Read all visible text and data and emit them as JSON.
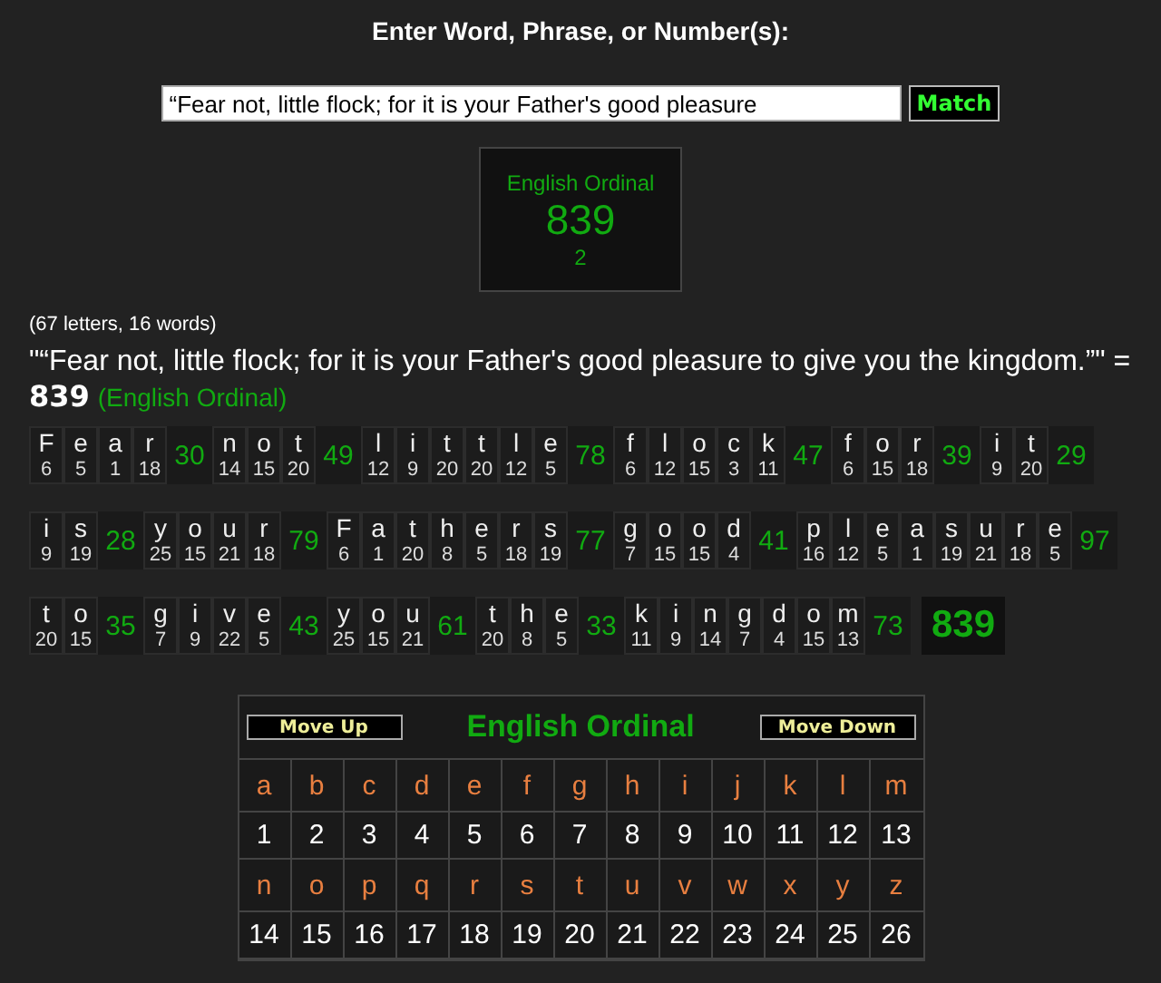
{
  "heading": "Enter Word, Phrase, or Number(s):",
  "search": {
    "value": "“Fear not, little flock; for it is your Father's good pleasure",
    "button": "Match"
  },
  "result_card": {
    "cipher": "English Ordinal",
    "total": "839",
    "count": "2"
  },
  "summary": {
    "counts": "(67 letters, 16 words)",
    "phrase": "\"“Fear not, little flock; for it is your Father's good pleasure to give you the kingdom.”\" =",
    "total": "839",
    "cipher": "(English Ordinal)"
  },
  "breakdown": {
    "lines": [
      {
        "words": [
          {
            "letters": [
              {
                "char": "F",
                "value": "6"
              },
              {
                "char": "e",
                "value": "5"
              },
              {
                "char": "a",
                "value": "1"
              },
              {
                "char": "r",
                "value": "18"
              }
            ],
            "total": "30"
          },
          {
            "letters": [
              {
                "char": "n",
                "value": "14"
              },
              {
                "char": "o",
                "value": "15"
              },
              {
                "char": "t",
                "value": "20"
              }
            ],
            "total": "49"
          },
          {
            "letters": [
              {
                "char": "l",
                "value": "12"
              },
              {
                "char": "i",
                "value": "9"
              },
              {
                "char": "t",
                "value": "20"
              },
              {
                "char": "t",
                "value": "20"
              },
              {
                "char": "l",
                "value": "12"
              },
              {
                "char": "e",
                "value": "5"
              }
            ],
            "total": "78"
          },
          {
            "letters": [
              {
                "char": "f",
                "value": "6"
              },
              {
                "char": "l",
                "value": "12"
              },
              {
                "char": "o",
                "value": "15"
              },
              {
                "char": "c",
                "value": "3"
              },
              {
                "char": "k",
                "value": "11"
              }
            ],
            "total": "47"
          },
          {
            "letters": [
              {
                "char": "f",
                "value": "6"
              },
              {
                "char": "o",
                "value": "15"
              },
              {
                "char": "r",
                "value": "18"
              }
            ],
            "total": "39"
          },
          {
            "letters": [
              {
                "char": "i",
                "value": "9"
              },
              {
                "char": "t",
                "value": "20"
              }
            ],
            "total": "29"
          }
        ]
      },
      {
        "words": [
          {
            "letters": [
              {
                "char": "i",
                "value": "9"
              },
              {
                "char": "s",
                "value": "19"
              }
            ],
            "total": "28"
          },
          {
            "letters": [
              {
                "char": "y",
                "value": "25"
              },
              {
                "char": "o",
                "value": "15"
              },
              {
                "char": "u",
                "value": "21"
              },
              {
                "char": "r",
                "value": "18"
              }
            ],
            "total": "79"
          },
          {
            "letters": [
              {
                "char": "F",
                "value": "6"
              },
              {
                "char": "a",
                "value": "1"
              },
              {
                "char": "t",
                "value": "20"
              },
              {
                "char": "h",
                "value": "8"
              },
              {
                "char": "e",
                "value": "5"
              },
              {
                "char": "r",
                "value": "18"
              },
              {
                "char": "s",
                "value": "19"
              }
            ],
            "total": "77"
          },
          {
            "letters": [
              {
                "char": "g",
                "value": "7"
              },
              {
                "char": "o",
                "value": "15"
              },
              {
                "char": "o",
                "value": "15"
              },
              {
                "char": "d",
                "value": "4"
              }
            ],
            "total": "41"
          },
          {
            "letters": [
              {
                "char": "p",
                "value": "16"
              },
              {
                "char": "l",
                "value": "12"
              },
              {
                "char": "e",
                "value": "5"
              },
              {
                "char": "a",
                "value": "1"
              },
              {
                "char": "s",
                "value": "19"
              },
              {
                "char": "u",
                "value": "21"
              },
              {
                "char": "r",
                "value": "18"
              },
              {
                "char": "e",
                "value": "5"
              }
            ],
            "total": "97"
          }
        ]
      },
      {
        "words": [
          {
            "letters": [
              {
                "char": "t",
                "value": "20"
              },
              {
                "char": "o",
                "value": "15"
              }
            ],
            "total": "35"
          },
          {
            "letters": [
              {
                "char": "g",
                "value": "7"
              },
              {
                "char": "i",
                "value": "9"
              },
              {
                "char": "v",
                "value": "22"
              },
              {
                "char": "e",
                "value": "5"
              }
            ],
            "total": "43"
          },
          {
            "letters": [
              {
                "char": "y",
                "value": "25"
              },
              {
                "char": "o",
                "value": "15"
              },
              {
                "char": "u",
                "value": "21"
              }
            ],
            "total": "61"
          },
          {
            "letters": [
              {
                "char": "t",
                "value": "20"
              },
              {
                "char": "h",
                "value": "8"
              },
              {
                "char": "e",
                "value": "5"
              }
            ],
            "total": "33"
          },
          {
            "letters": [
              {
                "char": "k",
                "value": "11"
              },
              {
                "char": "i",
                "value": "9"
              },
              {
                "char": "n",
                "value": "14"
              },
              {
                "char": "g",
                "value": "7"
              },
              {
                "char": "d",
                "value": "4"
              },
              {
                "char": "o",
                "value": "15"
              },
              {
                "char": "m",
                "value": "13"
              }
            ],
            "total": "73"
          }
        ],
        "grand_total": "839"
      }
    ]
  },
  "cipher_table": {
    "move_up": "Move Up",
    "title": "English Ordinal",
    "move_down": "Move Down",
    "cells": [
      {
        "letter": "a",
        "value": "1"
      },
      {
        "letter": "b",
        "value": "2"
      },
      {
        "letter": "c",
        "value": "3"
      },
      {
        "letter": "d",
        "value": "4"
      },
      {
        "letter": "e",
        "value": "5"
      },
      {
        "letter": "f",
        "value": "6"
      },
      {
        "letter": "g",
        "value": "7"
      },
      {
        "letter": "h",
        "value": "8"
      },
      {
        "letter": "i",
        "value": "9"
      },
      {
        "letter": "j",
        "value": "10"
      },
      {
        "letter": "k",
        "value": "11"
      },
      {
        "letter": "l",
        "value": "12"
      },
      {
        "letter": "m",
        "value": "13"
      },
      {
        "letter": "n",
        "value": "14"
      },
      {
        "letter": "o",
        "value": "15"
      },
      {
        "letter": "p",
        "value": "16"
      },
      {
        "letter": "q",
        "value": "17"
      },
      {
        "letter": "r",
        "value": "18"
      },
      {
        "letter": "s",
        "value": "19"
      },
      {
        "letter": "t",
        "value": "20"
      },
      {
        "letter": "u",
        "value": "21"
      },
      {
        "letter": "v",
        "value": "22"
      },
      {
        "letter": "w",
        "value": "23"
      },
      {
        "letter": "x",
        "value": "24"
      },
      {
        "letter": "y",
        "value": "25"
      },
      {
        "letter": "z",
        "value": "26"
      }
    ]
  }
}
